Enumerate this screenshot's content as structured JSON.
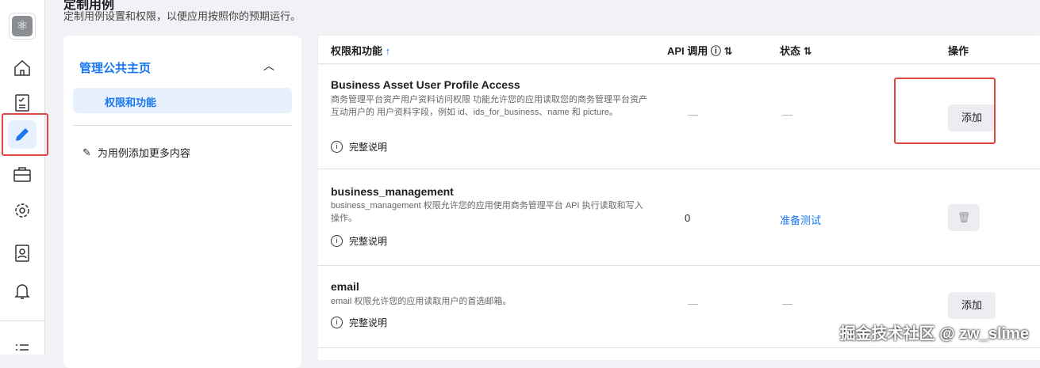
{
  "header": {
    "title": "定制用例",
    "subtitle": "定制用例设置和权限，以便应用按照你的预期运行。"
  },
  "left_panel": {
    "group": "管理公共主页",
    "selected_item": "权限和功能",
    "add_more": "为用例添加更多内容"
  },
  "table": {
    "columns": [
      "权限和功能",
      "API 调用",
      "状态",
      "操作"
    ],
    "rows": [
      {
        "name": "Business Asset User Profile Access",
        "description": "商务管理平台资产用户资料访问权限 功能允许您的应用读取您的商务管理平台资产互动用户的 用户资料字段，例如 id、ids_for_business、name 和 picture。",
        "link": "完整说明",
        "api_calls": "—",
        "status": "—",
        "action": "添加"
      },
      {
        "name": "business_management",
        "description": "business_management 权限允许您的应用使用商务管理平台 API 执行读取和写入操作。",
        "link": "完整说明",
        "api_calls": "0",
        "status": "准备测试",
        "action": "delete"
      },
      {
        "name": "email",
        "description": "email 权限允许您的应用读取用户的首选邮箱。",
        "link": "完整说明",
        "api_calls": "—",
        "status": "—",
        "action": "添加"
      }
    ]
  },
  "watermark": "掘金技术社区 @ zw_slime",
  "colors": {
    "accent": "#1877f2",
    "highlight": "#e0463e"
  }
}
